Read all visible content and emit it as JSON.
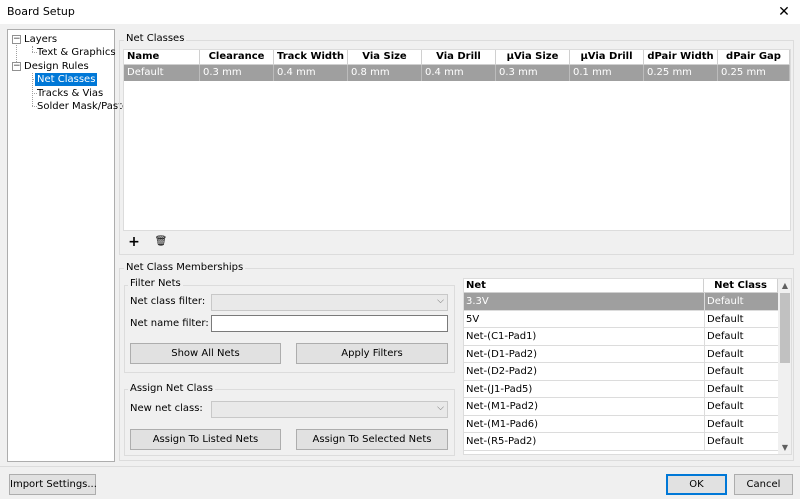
{
  "window": {
    "title": "Board Setup",
    "close_glyph": "✕"
  },
  "tree": {
    "layers": {
      "label": "Layers",
      "toggle": "−",
      "children": [
        "Text & Graphics"
      ]
    },
    "design_rules": {
      "label": "Design Rules",
      "toggle": "−",
      "children": [
        "Net Classes",
        "Tracks & Vias",
        "Solder Mask/Paste"
      ]
    }
  },
  "net_classes": {
    "group_label": "Net Classes",
    "columns": [
      "Name",
      "Clearance",
      "Track Width",
      "Via Size",
      "Via Drill",
      "μVia Size",
      "μVia Drill",
      "dPair Width",
      "dPair Gap"
    ],
    "rows": [
      [
        "Default",
        "0.3 mm",
        "0.4 mm",
        "0.8 mm",
        "0.4 mm",
        "0.3 mm",
        "0.1 mm",
        "0.25 mm",
        "0.25 mm"
      ]
    ],
    "add_glyph": "+",
    "delete_glyph": "🗑"
  },
  "memberships": {
    "group_label": "Net Class Memberships",
    "filter": {
      "group_label": "Filter Nets",
      "net_class_filter_label": "Net class filter:",
      "net_class_filter_value": "",
      "net_name_filter_label": "Net name filter:",
      "net_name_filter_value": "",
      "show_all_label": "Show All Nets",
      "apply_label": "Apply Filters"
    },
    "assign": {
      "group_label": "Assign Net Class",
      "new_class_label": "New net class:",
      "new_class_value": "",
      "assign_listed_label": "Assign To Listed Nets",
      "assign_selected_label": "Assign To Selected Nets"
    },
    "nets_table": {
      "columns": [
        "Net",
        "Net Class"
      ],
      "rows": [
        [
          "3.3V",
          "Default"
        ],
        [
          "5V",
          "Default"
        ],
        [
          "Net-(C1-Pad1)",
          "Default"
        ],
        [
          "Net-(D1-Pad2)",
          "Default"
        ],
        [
          "Net-(D2-Pad2)",
          "Default"
        ],
        [
          "Net-(J1-Pad5)",
          "Default"
        ],
        [
          "Net-(M1-Pad2)",
          "Default"
        ],
        [
          "Net-(M1-Pad6)",
          "Default"
        ],
        [
          "Net-(R5-Pad2)",
          "Default"
        ]
      ]
    }
  },
  "footer": {
    "import_label": "Import Settings...",
    "ok_label": "OK",
    "cancel_label": "Cancel"
  },
  "colors": {
    "selection": "#0078d7",
    "row_selected": "#9f9f9f"
  }
}
